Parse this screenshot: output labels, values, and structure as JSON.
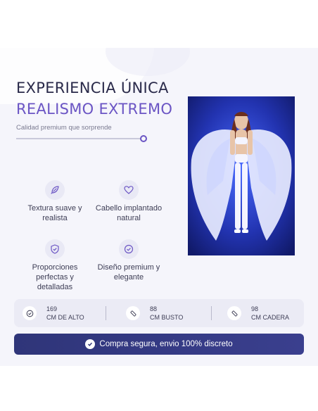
{
  "hero": {
    "title_line1": "EXPERIENCIA ÚNICA",
    "title_line2": "REALISMO EXTREMO",
    "subtitle": "Calidad premium que sorprende"
  },
  "features": [
    {
      "icon": "feather-icon",
      "label": "Textura suave y realista"
    },
    {
      "icon": "heart-icon",
      "label": "Cabello implantado natural"
    },
    {
      "icon": "shield-check-icon",
      "label": "Proporciones perfectas y detalladas"
    },
    {
      "icon": "check-circle-icon",
      "label": "Diseño premium y elegante"
    }
  ],
  "specs": [
    {
      "icon": "check-circle-icon",
      "value": "169",
      "unit": "CM DE ALTO"
    },
    {
      "icon": "tape-measure-icon",
      "value": "88",
      "unit": "CM BUSTO"
    },
    {
      "icon": "tape-measure-icon",
      "value": "98",
      "unit": "CM CADERA"
    }
  ],
  "banner": {
    "icon": "check-circle-icon",
    "text": "Compra segura, envio 100% discreto"
  },
  "colors": {
    "accent": "#6b55c4",
    "banner": "#2f3579",
    "panel": "#f5f5fb"
  }
}
